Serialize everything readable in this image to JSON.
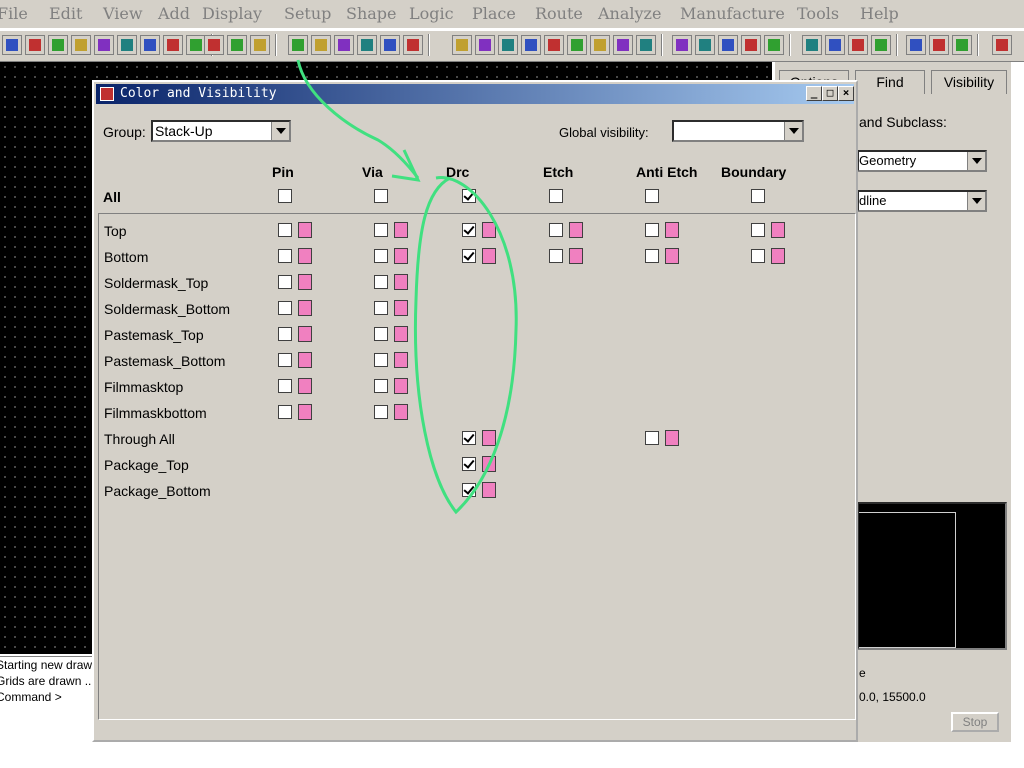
{
  "menubar": {
    "items": [
      "File",
      "Edit",
      "View",
      "Add",
      "Display",
      "Setup",
      "Shape",
      "Logic",
      "Place",
      "Route",
      "Analyze",
      "Manufacture",
      "Tools",
      "Help"
    ]
  },
  "console": {
    "lines": [
      "Starting new drawing...",
      "Grids are drawn ...",
      "Command >"
    ]
  },
  "right_panel": {
    "tabs": [
      "Options",
      "Find",
      "Visibility"
    ],
    "subclass_label": "and Subclass:",
    "class_value": "Geometry",
    "subclass_value": "dline",
    "status_letter": "e",
    "coordinates": "0.0, 15500.0",
    "stop_label": "Stop"
  },
  "dialog": {
    "title": "Color and Visibility",
    "group_label": "Group:",
    "group_value": "Stack-Up",
    "global_visibility_label": "Global visibility:",
    "global_visibility_value": "",
    "columns": [
      "Pin",
      "Via",
      "Drc",
      "Etch",
      "Anti Etch",
      "Boundary"
    ],
    "all_label": "All",
    "all_checked": [
      false,
      false,
      true,
      false,
      false,
      false
    ],
    "rows": [
      {
        "name": "Top",
        "cells": [
          {
            "c": false
          },
          {
            "c": false
          },
          {
            "c": true
          },
          {
            "c": false
          },
          {
            "c": false
          },
          {
            "c": false
          }
        ]
      },
      {
        "name": "Bottom",
        "cells": [
          {
            "c": false
          },
          {
            "c": false
          },
          {
            "c": true
          },
          {
            "c": false
          },
          {
            "c": false
          },
          {
            "c": false
          }
        ]
      },
      {
        "name": "Soldermask_Top",
        "cells": [
          {
            "c": false
          },
          {
            "c": false
          },
          null,
          null,
          null,
          null
        ]
      },
      {
        "name": "Soldermask_Bottom",
        "cells": [
          {
            "c": false
          },
          {
            "c": false
          },
          null,
          null,
          null,
          null
        ]
      },
      {
        "name": "Pastemask_Top",
        "cells": [
          {
            "c": false
          },
          {
            "c": false
          },
          null,
          null,
          null,
          null
        ]
      },
      {
        "name": "Pastemask_Bottom",
        "cells": [
          {
            "c": false
          },
          {
            "c": false
          },
          null,
          null,
          null,
          null
        ]
      },
      {
        "name": "Filmmasktop",
        "cells": [
          {
            "c": false
          },
          {
            "c": false
          },
          null,
          null,
          null,
          null
        ]
      },
      {
        "name": "Filmmaskbottom",
        "cells": [
          {
            "c": false
          },
          {
            "c": false
          },
          null,
          null,
          null,
          null
        ]
      },
      {
        "name": "Through All",
        "cells": [
          null,
          null,
          {
            "c": true
          },
          null,
          {
            "c": false
          },
          null
        ]
      },
      {
        "name": "Package_Top",
        "cells": [
          null,
          null,
          {
            "c": true
          },
          null,
          null,
          null
        ]
      },
      {
        "name": "Package_Bottom",
        "cells": [
          null,
          null,
          {
            "c": true
          },
          null,
          null,
          null
        ]
      }
    ]
  },
  "colors": {
    "swatch": "#f080c0",
    "annotation": "#40e080",
    "title_bar": "#0a246a"
  }
}
